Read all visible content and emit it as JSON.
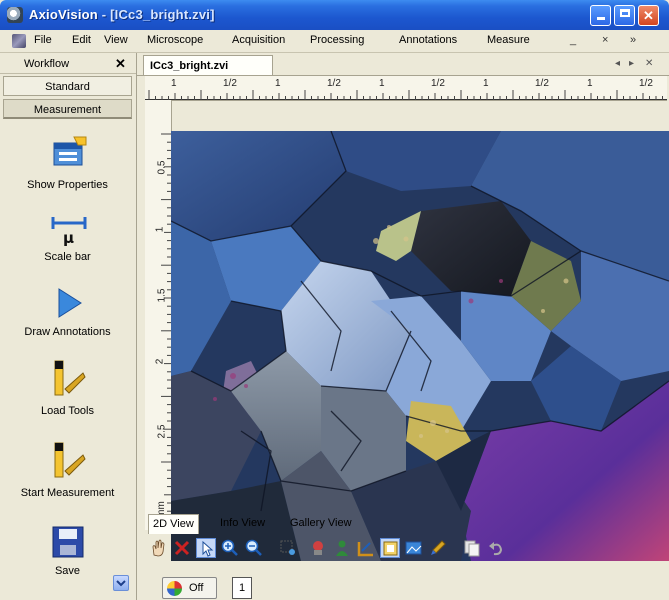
{
  "window": {
    "app_name": "AxioVision",
    "title_separator": " - ",
    "document_title": "[ICc3_bright.zvi]"
  },
  "menu": {
    "items": [
      "File",
      "Edit",
      "View",
      "Microscope",
      "Acquisition",
      "Processing",
      "Annotations",
      "Measure"
    ],
    "mdi_controls": [
      "_",
      "×",
      "»"
    ]
  },
  "workflow": {
    "title": "Workflow",
    "close": "✕",
    "tabs": [
      "Standard",
      "Measurement"
    ],
    "items": [
      {
        "label": "Show Properties",
        "icon": "properties-icon"
      },
      {
        "label": "Scale bar",
        "icon": "scale-bar-icon"
      },
      {
        "label": "Draw Annotations",
        "icon": "play-arrow-icon"
      },
      {
        "label": "Load Tools",
        "icon": "load-tools-icon"
      },
      {
        "label": "Start Measurement",
        "icon": "start-measurement-icon"
      },
      {
        "label": "Save",
        "icon": "floppy-disk-icon"
      }
    ]
  },
  "document": {
    "tab_label": "ICc3_bright.zvi",
    "ruler_h_labels": [
      "1",
      "1/2",
      "1",
      "1/2",
      "1",
      "1/2",
      "1",
      "1/2",
      "1",
      "1/2"
    ],
    "ruler_v_labels": [
      "0.5",
      "1",
      "1.5",
      "2",
      "2.5",
      "mm"
    ]
  },
  "view_tabs": [
    "2D View",
    "Info View",
    "Gallery View"
  ],
  "toolbar": {
    "icons": [
      "hand-pan-icon",
      "cross-delete-icon",
      "pointer-select-icon",
      "zoom-in-icon",
      "zoom-out-icon",
      "region-icon",
      "stamp-icon",
      "person-icon",
      "scale-icon",
      "frame-selected-icon",
      "image-icon",
      "brush-icon",
      "copy-icon",
      "undo-icon"
    ],
    "selected_index": 2
  },
  "status": {
    "live_label": "Off",
    "channel_number": "1"
  },
  "colors": {
    "titlebar": "#1c57cf",
    "panel_bg": "#ece9d8",
    "accent_blue": "#2a6fe0"
  }
}
